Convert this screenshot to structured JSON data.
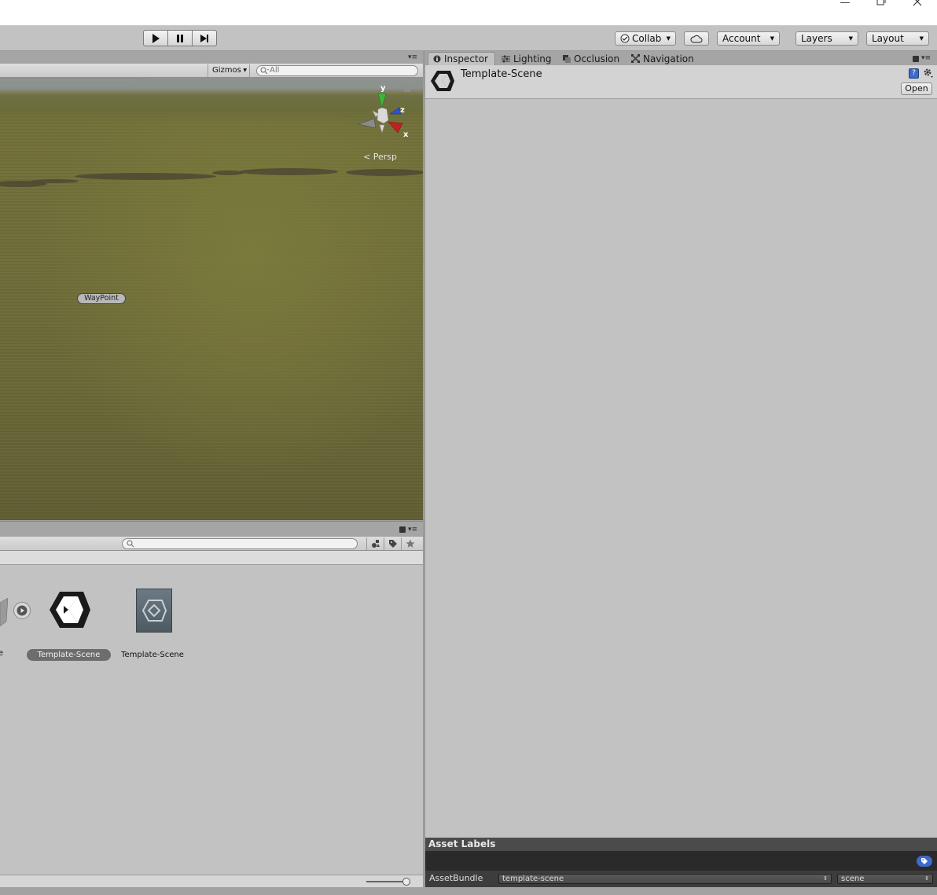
{
  "toolbar": {
    "collab_label": "Collab",
    "account_label": "Account",
    "layers_label": "Layers",
    "layout_label": "Layout"
  },
  "scene": {
    "gizmos_label": "Gizmos",
    "search_placeholder": "All",
    "axis_y": "y",
    "axis_z": "z",
    "axis_x": "x",
    "persp_label": "Persp",
    "waypoint_label": "WayPoint"
  },
  "project": {
    "search_placeholder": "",
    "assets": [
      {
        "label": "Template-Scene",
        "selected": true
      },
      {
        "label": "Template-Scene",
        "selected": false
      }
    ],
    "partial_label": "e"
  },
  "inspector": {
    "tabs": [
      "Inspector",
      "Lighting",
      "Occlusion",
      "Navigation"
    ],
    "object_title": "Template-Scene",
    "open_label": "Open",
    "asset_labels_heading": "Asset Labels",
    "asset_bundle_label": "AssetBundle",
    "asset_bundle_value": "template-scene",
    "asset_variant_value": "scene"
  },
  "colors": {
    "accent_blue": "#3c6bc9",
    "gizmo_y": "#3bb53b",
    "gizmo_z": "#2a52d8",
    "gizmo_x": "#c02222"
  }
}
